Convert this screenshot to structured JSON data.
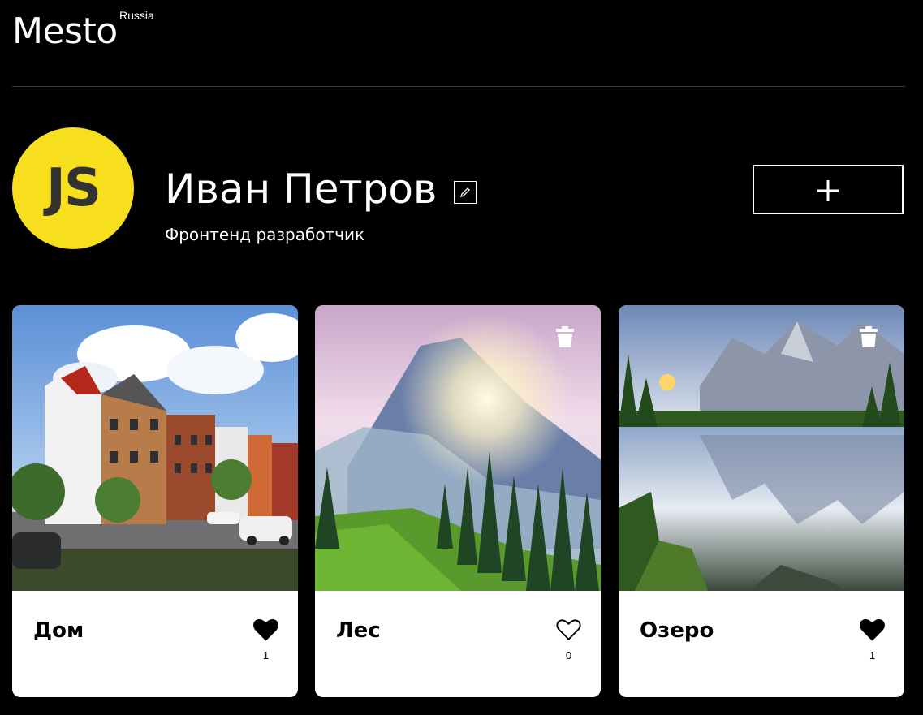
{
  "header": {
    "logo": "Mesto",
    "logo_sup": "Russia"
  },
  "profile": {
    "avatar_text": "JS",
    "avatar_color": "#f7df1e",
    "name": "Иван Петров",
    "about": "Фронтенд разработчик",
    "edit_icon": "pencil-icon",
    "add_icon": "plus-icon"
  },
  "cards": [
    {
      "title": "Дом",
      "likes": "1",
      "liked": true
    },
    {
      "title": "Лес",
      "likes": "0",
      "liked": false
    },
    {
      "title": "Озеро",
      "likes": "1",
      "liked": true
    }
  ]
}
